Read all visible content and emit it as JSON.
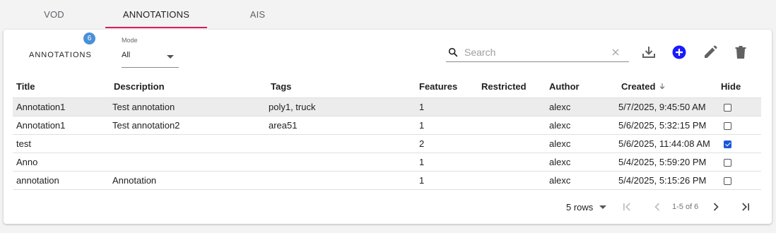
{
  "tabs": [
    {
      "label": "VOD"
    },
    {
      "label": "ANNOTATIONS"
    },
    {
      "label": "AIS"
    }
  ],
  "accent_color": "#d81b60",
  "header": {
    "title": "ANNOTATIONS",
    "count_badge": "6"
  },
  "mode": {
    "label": "Mode",
    "value": "All"
  },
  "search": {
    "placeholder": "Search",
    "value": ""
  },
  "toolbar": {
    "icons": [
      "download-icon",
      "add-circle-icon",
      "edit-icon",
      "delete-icon"
    ],
    "add_color": "#1a1aff"
  },
  "table": {
    "columns": [
      "Title",
      "Description",
      "Tags",
      "Features",
      "Restricted",
      "Author",
      "Created",
      "Hide"
    ],
    "sort": {
      "column": "Created",
      "direction": "desc"
    },
    "rows": [
      {
        "title": "Annotation1",
        "description": "Test annotation",
        "tags": "poly1, truck",
        "features": "1",
        "restricted": "",
        "author": "alexc",
        "created": "5/7/2025, 9:45:50 AM",
        "hide": false
      },
      {
        "title": "Annotation1",
        "description": "Test annotation2",
        "tags": "area51",
        "features": "1",
        "restricted": "",
        "author": "alexc",
        "created": "5/6/2025, 5:32:15 PM",
        "hide": false
      },
      {
        "title": "test",
        "description": "",
        "tags": "",
        "features": "2",
        "restricted": "",
        "author": "alexc",
        "created": "5/6/2025, 11:44:08 AM",
        "hide": true
      },
      {
        "title": "Anno",
        "description": "",
        "tags": "",
        "features": "1",
        "restricted": "",
        "author": "alexc",
        "created": "5/4/2025, 5:59:20 PM",
        "hide": false
      },
      {
        "title": "annotation",
        "description": "Annotation",
        "tags": "",
        "features": "1",
        "restricted": "",
        "author": "alexc",
        "created": "5/4/2025, 5:15:26 PM",
        "hide": false
      }
    ]
  },
  "pagination": {
    "rows_per_page": "5 rows",
    "range": "1-5 of 6"
  }
}
